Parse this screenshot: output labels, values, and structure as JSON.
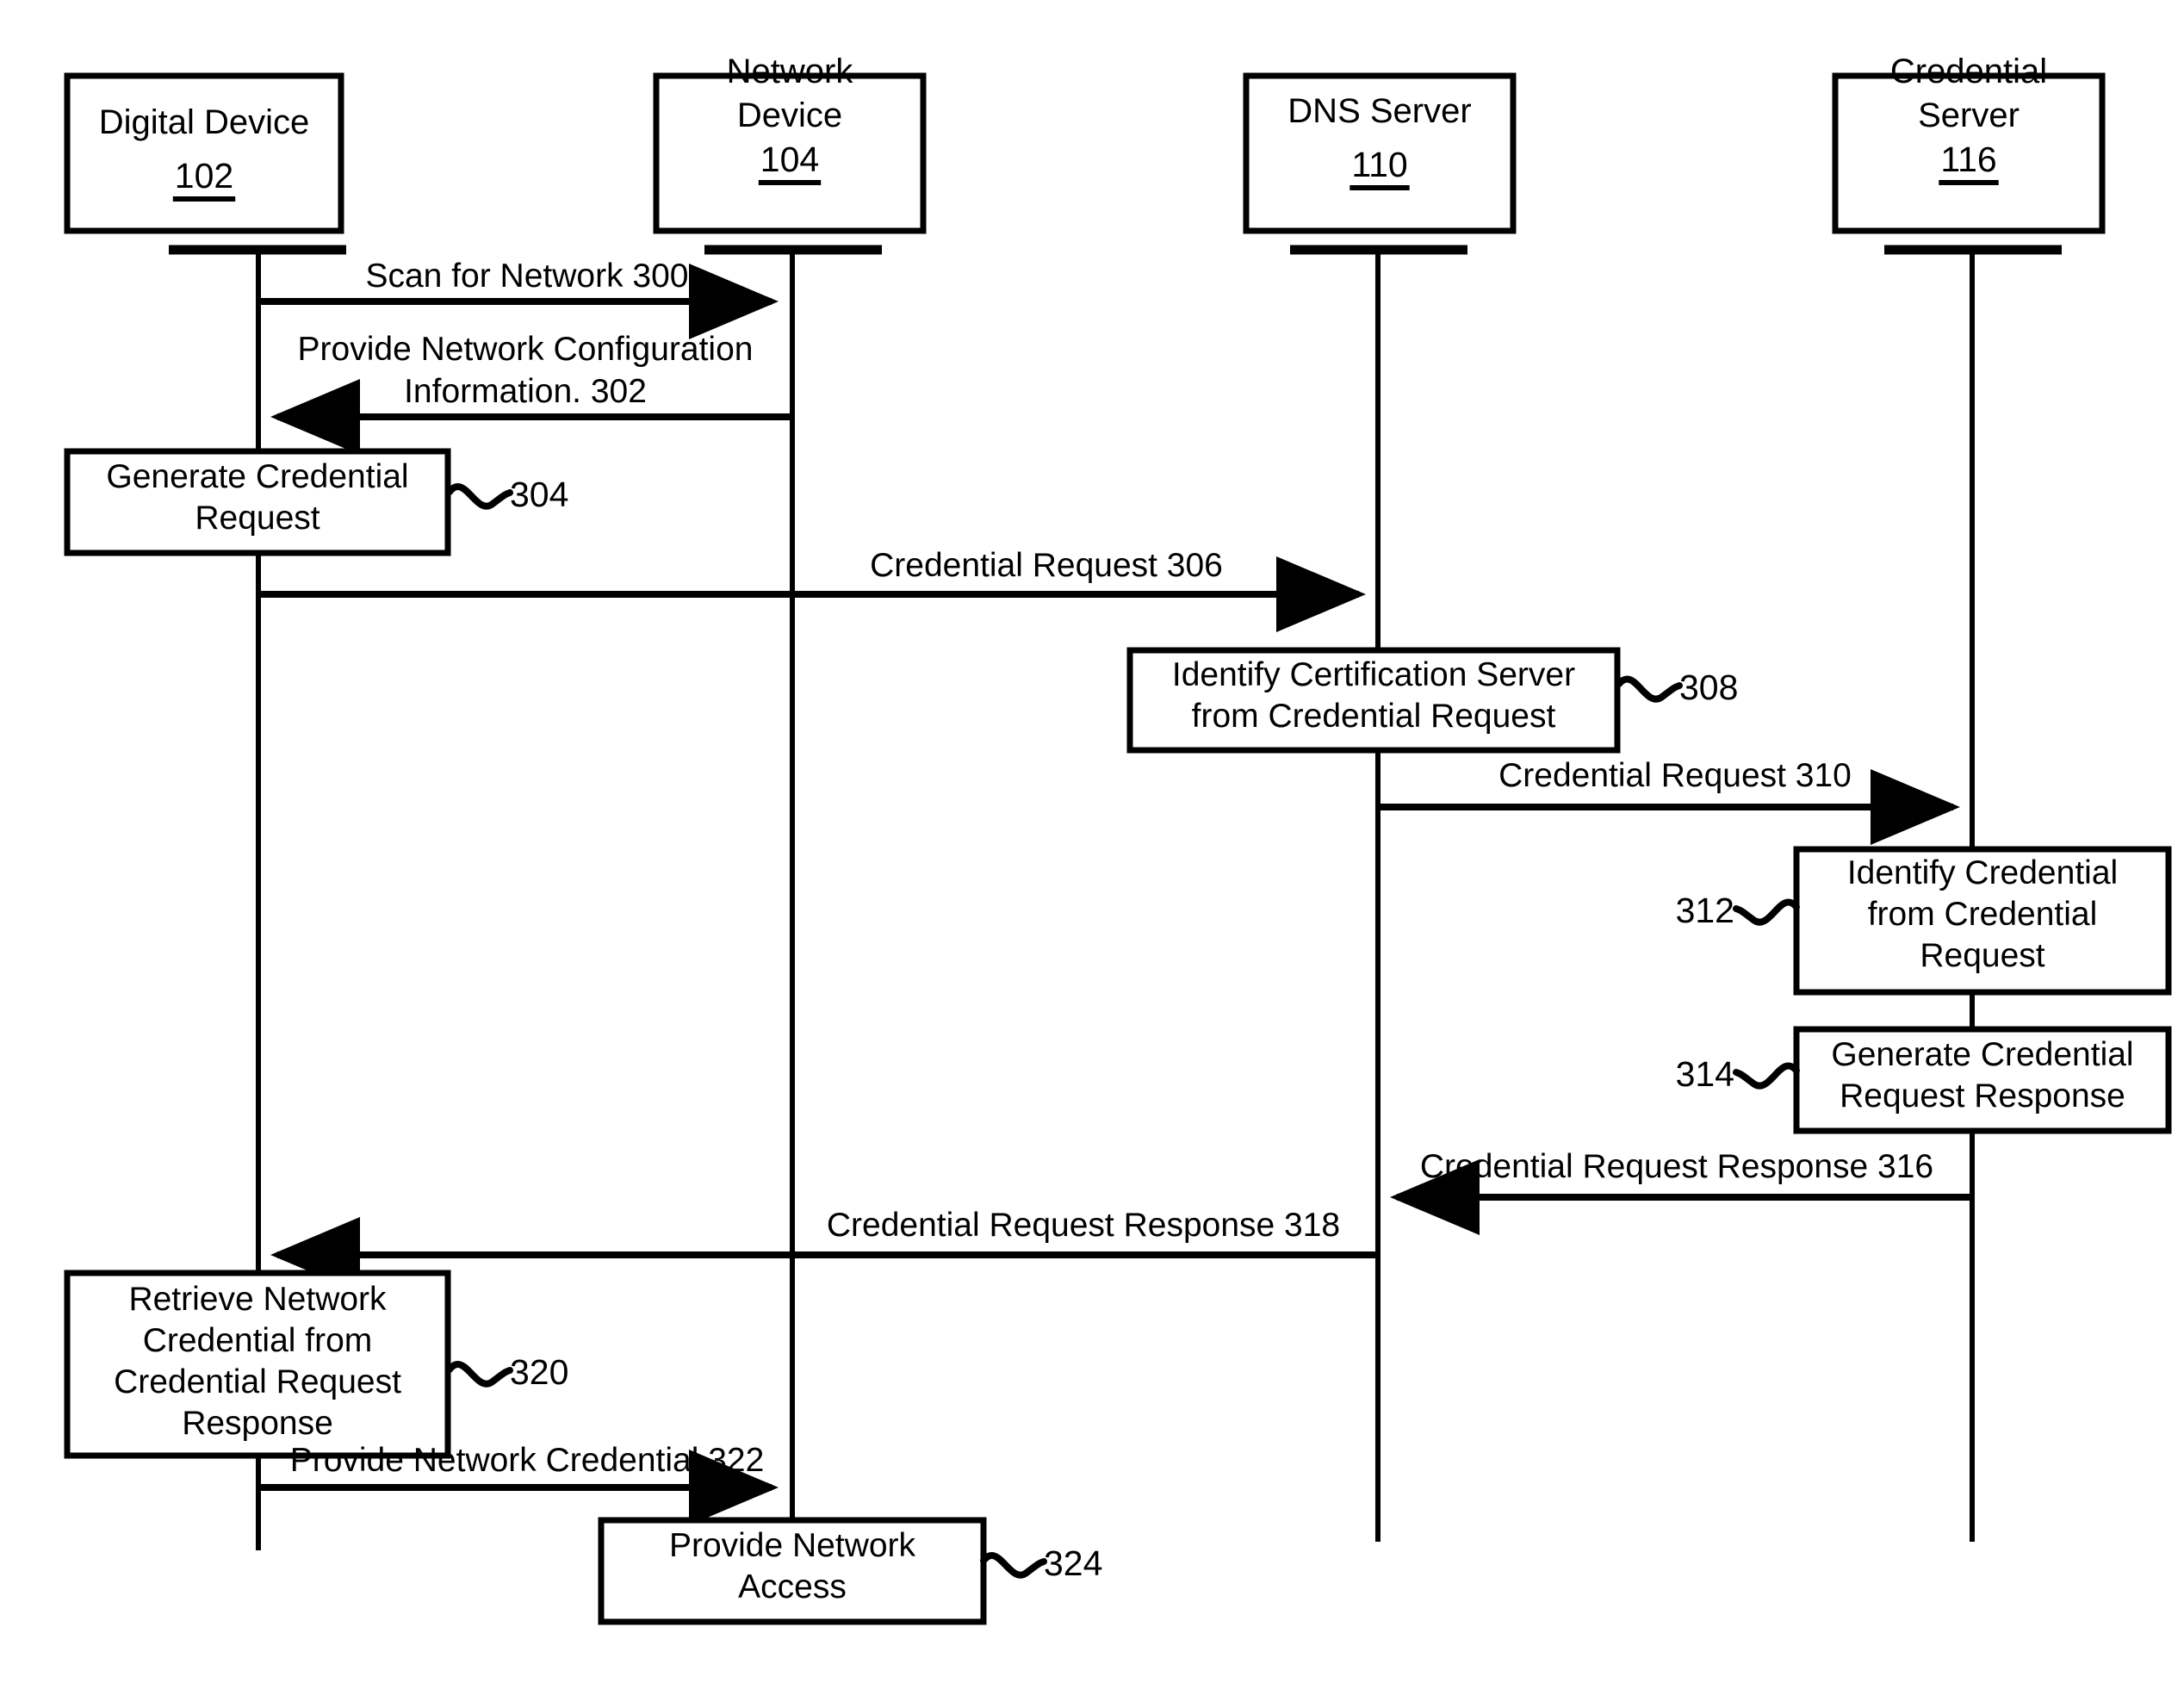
{
  "figure": {
    "type": "patent-sequence-diagram",
    "background_color": "#ffffff",
    "line_color": "#000000"
  },
  "lifelines": [
    {
      "id": "digital-device",
      "name": "Digital Device",
      "name_line1": "Digital Device",
      "name_line2": "",
      "ref": "102"
    },
    {
      "id": "network-device",
      "name": "Network Device",
      "name_line1": "Network",
      "name_line2": "Device",
      "ref": "104"
    },
    {
      "id": "dns-server",
      "name": "DNS Server",
      "name_line1": "DNS Server",
      "name_line2": "",
      "ref": "110"
    },
    {
      "id": "credential-server",
      "name": "Credential Server",
      "name_line1": "Credential",
      "name_line2": "Server",
      "ref": "116"
    }
  ],
  "messages": [
    {
      "id": "m300",
      "label": "Scan for Network 300",
      "ref": "300",
      "from": "digital-device",
      "to": "network-device",
      "direction": "right"
    },
    {
      "id": "m302",
      "label_line1": "Provide Network Configuration",
      "label_line2": "Information. 302",
      "ref": "302",
      "from": "network-device",
      "to": "digital-device",
      "direction": "left"
    },
    {
      "id": "m306",
      "label": "Credential Request 306",
      "ref": "306",
      "from": "digital-device",
      "to": "dns-server",
      "direction": "right"
    },
    {
      "id": "m310",
      "label": "Credential Request 310",
      "ref": "310",
      "from": "dns-server",
      "to": "credential-server",
      "direction": "right"
    },
    {
      "id": "m316",
      "label": "Credential Request Response 316",
      "ref": "316",
      "from": "credential-server",
      "to": "dns-server",
      "direction": "left"
    },
    {
      "id": "m318",
      "label": "Credential Request Response 318",
      "ref": "318",
      "from": "dns-server",
      "to": "digital-device",
      "direction": "left"
    },
    {
      "id": "m322",
      "label": "Provide Network Credential 322",
      "ref": "322",
      "from": "digital-device",
      "to": "network-device",
      "direction": "right"
    }
  ],
  "processes": [
    {
      "id": "p304",
      "ref": "304",
      "on": "digital-device",
      "ref_side": "right",
      "lines": [
        "Generate Credential",
        "Request"
      ]
    },
    {
      "id": "p308",
      "ref": "308",
      "on": "dns-server",
      "ref_side": "right",
      "lines": [
        "Identify Certification Server",
        "from Credential Request"
      ]
    },
    {
      "id": "p312",
      "ref": "312",
      "on": "credential-server",
      "ref_side": "left",
      "lines": [
        "Identify Credential",
        "from Credential",
        "Request"
      ]
    },
    {
      "id": "p314",
      "ref": "314",
      "on": "credential-server",
      "ref_side": "left",
      "lines": [
        "Generate Credential",
        "Request Response"
      ]
    },
    {
      "id": "p320",
      "ref": "320",
      "on": "digital-device",
      "ref_side": "right",
      "lines": [
        "Retrieve Network",
        "Credential from",
        "Credential Request",
        "Response"
      ]
    },
    {
      "id": "p324",
      "ref": "324",
      "on": "network-device",
      "ref_side": "right",
      "lines": [
        "Provide Network",
        "Access"
      ]
    }
  ]
}
